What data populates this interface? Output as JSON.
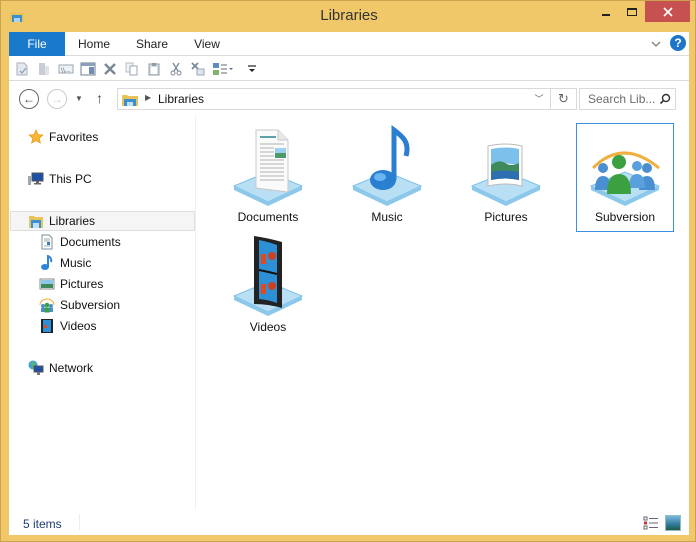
{
  "window": {
    "title": "Libraries",
    "controls": {
      "minimize": "minimize",
      "maximize": "maximize",
      "close": "close"
    },
    "accent_color": "#f0c86a",
    "close_color": "#c75050"
  },
  "ribbon": {
    "tabs": [
      {
        "label": "File",
        "active": true
      },
      {
        "label": "Home"
      },
      {
        "label": "Share"
      },
      {
        "label": "View"
      }
    ],
    "file_tab_color": "#1979ca",
    "help_label": "?",
    "quick_access": [
      {
        "icon": "properties-icon"
      },
      {
        "icon": "open-icon"
      },
      {
        "icon": "rename-icon"
      },
      {
        "icon": "preview-pane-icon"
      },
      {
        "icon": "delete-icon"
      },
      {
        "icon": "copy-icon"
      },
      {
        "icon": "paste-icon"
      },
      {
        "icon": "cut-icon"
      },
      {
        "icon": "clear-icon"
      },
      {
        "icon": "layout-icon"
      },
      {
        "icon": "customize-qat-icon"
      }
    ]
  },
  "navigation": {
    "back": "←",
    "forward": "→",
    "up": "↑",
    "address": {
      "breadcrumb": [
        "Libraries"
      ]
    },
    "refresh": "↻",
    "search": {
      "placeholder": "Search Lib..."
    }
  },
  "nav_pane": {
    "items": [
      {
        "label": "Favorites",
        "icon": "star-icon",
        "level": 0
      },
      {
        "label": "This PC",
        "icon": "computer-icon",
        "level": 0
      },
      {
        "label": "Libraries",
        "icon": "libraries-icon",
        "level": 0,
        "selected": true
      },
      {
        "label": "Documents",
        "icon": "documents-icon",
        "level": 1
      },
      {
        "label": "Music",
        "icon": "music-icon",
        "level": 1
      },
      {
        "label": "Pictures",
        "icon": "pictures-icon",
        "level": 1
      },
      {
        "label": "Subversion",
        "icon": "subversion-icon",
        "level": 1
      },
      {
        "label": "Videos",
        "icon": "videos-icon",
        "level": 1
      },
      {
        "label": "Network",
        "icon": "network-icon",
        "level": 0
      }
    ]
  },
  "content": {
    "libraries": [
      {
        "label": "Documents",
        "icon": "documents-library-icon"
      },
      {
        "label": "Music",
        "icon": "music-library-icon"
      },
      {
        "label": "Pictures",
        "icon": "pictures-library-icon"
      },
      {
        "label": "Subversion",
        "icon": "subversion-library-icon",
        "selected": true
      },
      {
        "label": "Videos",
        "icon": "videos-library-icon"
      }
    ]
  },
  "status": {
    "item_count": "5 items"
  }
}
